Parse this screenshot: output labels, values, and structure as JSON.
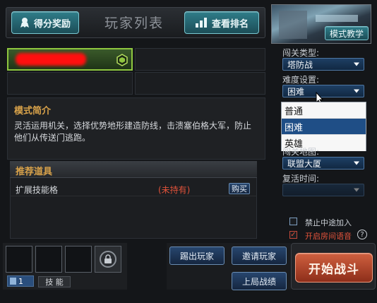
{
  "top": {
    "reward_button": "得分奖励",
    "title": "玩家列表",
    "rank_button": "查看排名"
  },
  "preview": {
    "tutorial_button": "模式教学"
  },
  "settings": {
    "level_type_label": "闯关类型:",
    "level_type_value": "塔防战",
    "difficulty_label": "难度设置:",
    "difficulty_value": "困难",
    "difficulty_options": [
      "普通",
      "困难",
      "英雄"
    ],
    "map_label": "闯关地图:",
    "map_value": "联盟大厦",
    "revive_label": "复活时间:",
    "revive_value": "",
    "no_join_label": "禁止中途加入",
    "voice_label": "开启房间语音",
    "help_icon_text": "?"
  },
  "mode_intro": {
    "heading": "模式简介",
    "text": "灵活运用机关，选择优势地形建造防线，击溃塞伯格大军，防止他们从传送门逃跑。"
  },
  "items": {
    "heading": "推荐道具",
    "rows": [
      {
        "name": "扩展技能格",
        "status": "(未持有)",
        "buy": "购买"
      }
    ]
  },
  "skills": {
    "count": "1",
    "label": "技 能"
  },
  "buttons": {
    "kick": "踢出玩家",
    "invite": "邀请玩家",
    "last_battle": "上局战绩",
    "start": "开始战斗"
  },
  "colors": {
    "accent_gold": "#d8a24a",
    "status_red": "#e0523a",
    "start_red": "#b8452a",
    "select_blue": "#1e3f64"
  }
}
